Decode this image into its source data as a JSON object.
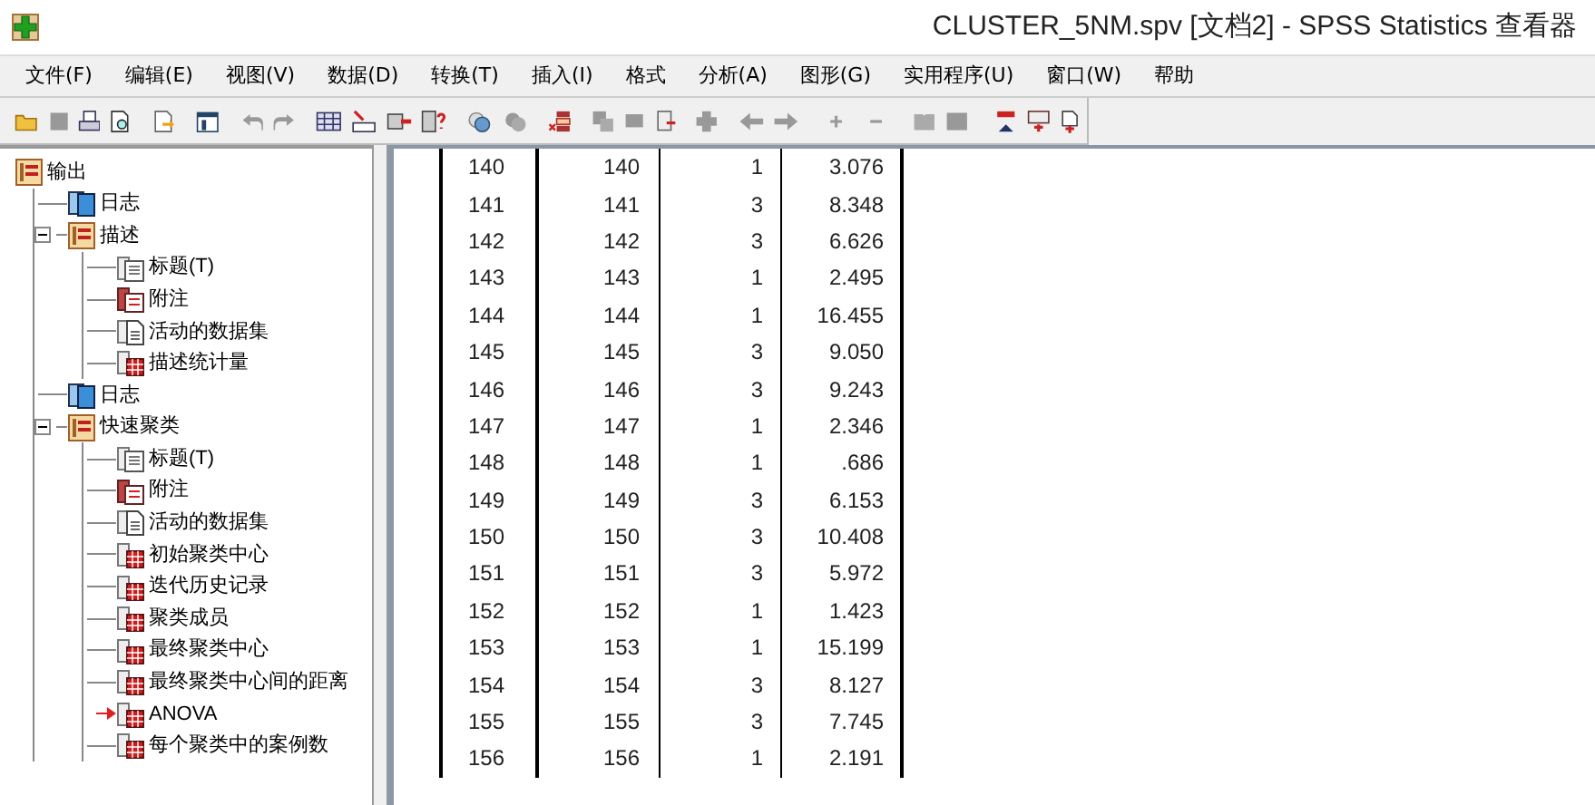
{
  "window": {
    "title": "CLUSTER_5NM.spv [文档2] - SPSS Statistics 查看器"
  },
  "menu": [
    "文件(F)",
    "编辑(E)",
    "视图(V)",
    "数据(D)",
    "转换(T)",
    "插入(I)",
    "格式",
    "分析(A)",
    "图形(G)",
    "实用程序(U)",
    "窗口(W)",
    "帮助"
  ],
  "outline": [
    {
      "label": "输出",
      "kind": "folder",
      "children": [
        {
          "label": "日志",
          "kind": "log",
          "current": false
        },
        {
          "label": "描述",
          "kind": "folder",
          "expanded": true,
          "current": false,
          "children": [
            {
              "label": "标题(T)",
              "kind": "title",
              "current": false
            },
            {
              "label": "附注",
              "kind": "note",
              "current": false
            },
            {
              "label": "活动的数据集",
              "kind": "dataset",
              "current": false
            },
            {
              "label": "描述统计量",
              "kind": "table",
              "current": false
            }
          ]
        },
        {
          "label": "日志",
          "kind": "log",
          "current": false
        },
        {
          "label": "快速聚类",
          "kind": "folder",
          "expanded": true,
          "current": false,
          "children": [
            {
              "label": "标题(T)",
              "kind": "title",
              "current": false
            },
            {
              "label": "附注",
              "kind": "note",
              "current": false
            },
            {
              "label": "活动的数据集",
              "kind": "dataset",
              "current": false
            },
            {
              "label": "初始聚类中心",
              "kind": "table",
              "current": false
            },
            {
              "label": "迭代历史记录",
              "kind": "table",
              "current": false
            },
            {
              "label": "聚类成员",
              "kind": "table",
              "current": false
            },
            {
              "label": "最终聚类中心",
              "kind": "table",
              "current": false
            },
            {
              "label": "最终聚类中心间的距离",
              "kind": "table",
              "current": false
            },
            {
              "label": "ANOVA",
              "kind": "table",
              "current": true
            },
            {
              "label": "每个聚类中的案例数",
              "kind": "table",
              "current": false
            }
          ]
        }
      ]
    }
  ],
  "table": {
    "rows": [
      [
        "140",
        "140",
        "1",
        "3.076"
      ],
      [
        "141",
        "141",
        "3",
        "8.348"
      ],
      [
        "142",
        "142",
        "3",
        "6.626"
      ],
      [
        "143",
        "143",
        "1",
        "2.495"
      ],
      [
        "144",
        "144",
        "1",
        "16.455"
      ],
      [
        "145",
        "145",
        "3",
        "9.050"
      ],
      [
        "146",
        "146",
        "3",
        "9.243"
      ],
      [
        "147",
        "147",
        "1",
        "2.346"
      ],
      [
        "148",
        "148",
        "1",
        ".686"
      ],
      [
        "149",
        "149",
        "3",
        "6.153"
      ],
      [
        "150",
        "150",
        "3",
        "10.408"
      ],
      [
        "151",
        "151",
        "3",
        "5.972"
      ],
      [
        "152",
        "152",
        "1",
        "1.423"
      ],
      [
        "153",
        "153",
        "1",
        "15.199"
      ],
      [
        "154",
        "154",
        "3",
        "8.127"
      ],
      [
        "155",
        "155",
        "3",
        "7.745"
      ],
      [
        "156",
        "156",
        "1",
        "2.191"
      ]
    ]
  }
}
